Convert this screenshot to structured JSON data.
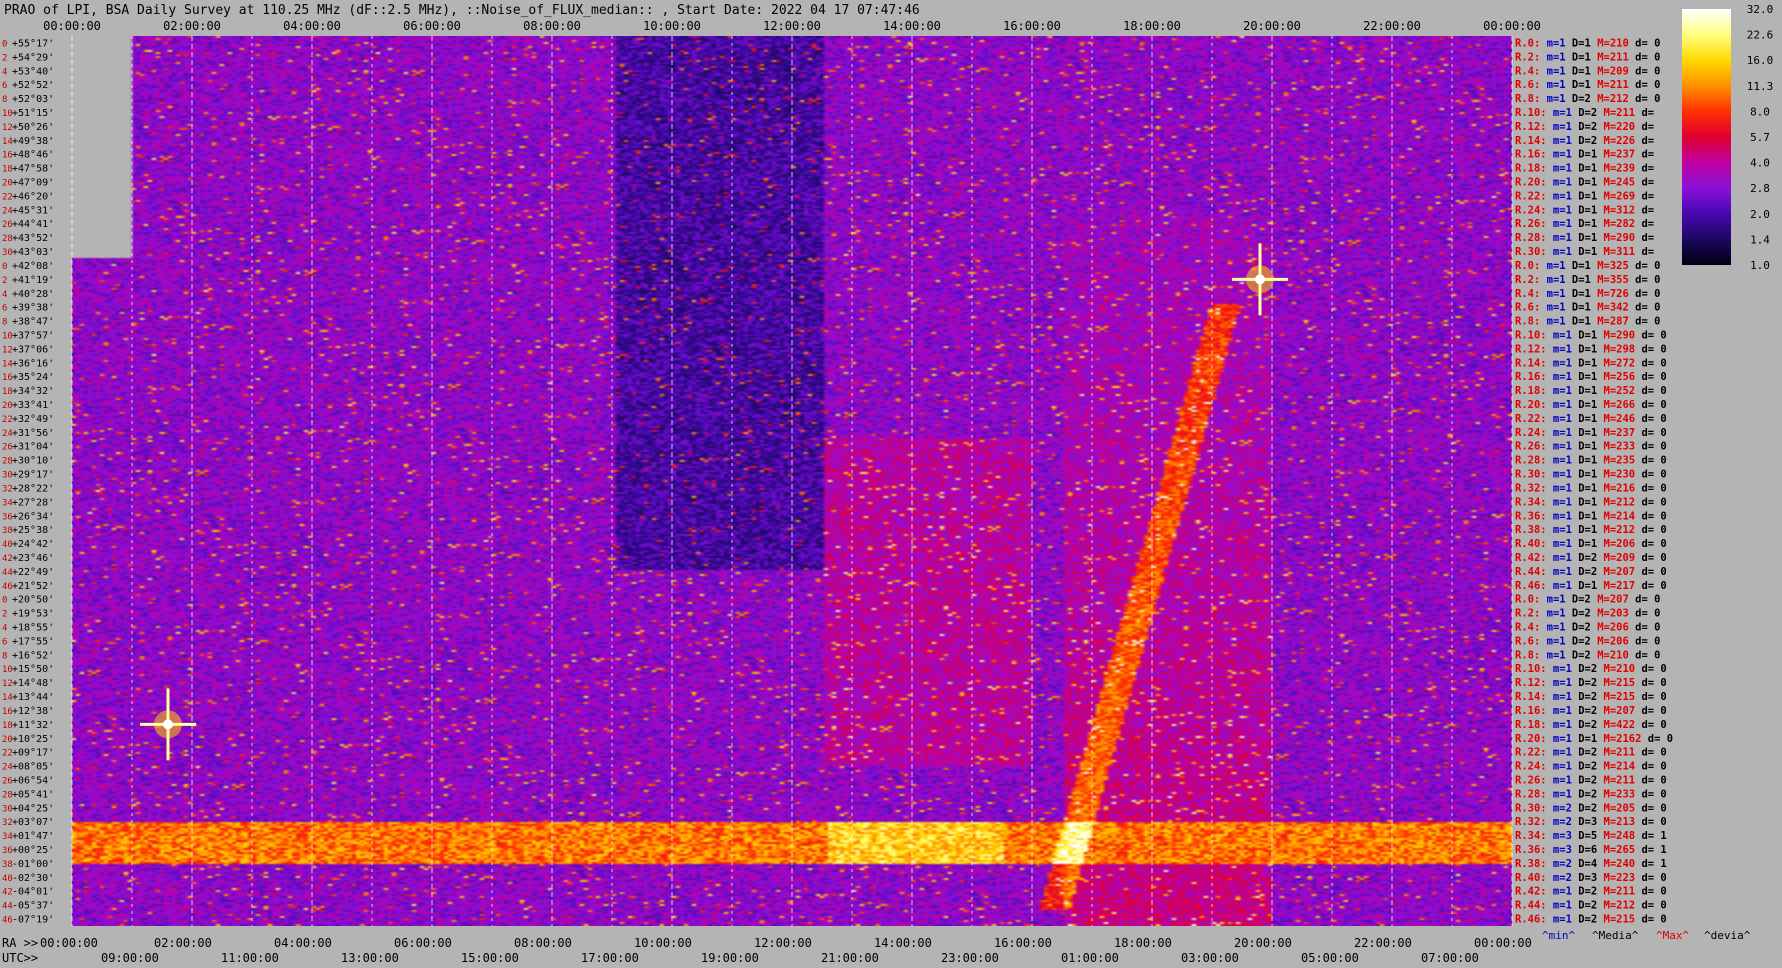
{
  "header": {
    "title": "PRAO of LPI, BSA Daily Survey at 110.25 MHz (dF::2.5 MHz), ::Noise_of_FLUX_median:: , Start Date: 2022 04 17 07:47:46"
  },
  "chart_data": {
    "type": "heatmap",
    "title": "PRAO of LPI, BSA Daily Survey at 110.25 MHz (dF::2.5 MHz), ::Noise_of_FLUX_median:: , Start Date: 2022 04 17 07:47:46",
    "x_top_ticks": [
      "00:00:00",
      "02:00:00",
      "04:00:00",
      "06:00:00",
      "08:00:00",
      "10:00:00",
      "12:00:00",
      "14:00:00",
      "16:00:00",
      "18:00:00",
      "20:00:00",
      "22:00:00",
      "00:00:00"
    ],
    "x_ra_prefix": "RA >>",
    "x_ra_ticks": [
      "00:00:00",
      "02:00:00",
      "04:00:00",
      "06:00:00",
      "08:00:00",
      "10:00:00",
      "12:00:00",
      "14:00:00",
      "16:00:00",
      "18:00:00",
      "20:00:00",
      "22:00:00",
      "00:00:00"
    ],
    "x_utc_prefix": "UTC>>",
    "x_utc_ticks": [
      "09:00:00",
      "11:00:00",
      "13:00:00",
      "15:00:00",
      "17:00:00",
      "19:00:00",
      "21:00:00",
      "23:00:00",
      "01:00:00",
      "03:00:00",
      "05:00:00",
      "07:00:00"
    ],
    "y_ticks": [
      "+55°17'",
      "+54°29'",
      "+53°40'",
      "+52°52'",
      "+52°03'",
      "+51°15'",
      "+50°26'",
      "+49°38'",
      "+48°46'",
      "+47°58'",
      "+47°09'",
      "+46°20'",
      "+45°31'",
      "+44°41'",
      "+43°52'",
      "+43°03'",
      "+42°08'",
      "+41°19'",
      "+40°28'",
      "+39°38'",
      "+38°47'",
      "+37°57'",
      "+37°06'",
      "+36°16'",
      "+35°24'",
      "+34°32'",
      "+33°41'",
      "+32°49'",
      "+31°56'",
      "+31°04'",
      "+30°10'",
      "+29°17'",
      "+28°22'",
      "+27°28'",
      "+26°34'",
      "+25°38'",
      "+24°42'",
      "+23°46'",
      "+22°49'",
      "+21°52'",
      "+20°50'",
      "+19°53'",
      "+18°55'",
      "+17°55'",
      "+16°52'",
      "+15°50'",
      "+14°48'",
      "+13°44'",
      "+12°38'",
      "+11°32'",
      "+10°25'",
      "+09°17'",
      "+08°05'",
      "+06°54'",
      "+05°41'",
      "+04°25'",
      "+03°07'",
      "+01°47'",
      "+00°25'",
      "-01°00'",
      "-02°30'",
      "-04°01'",
      "-05°37'",
      "-07°19'"
    ],
    "y_index_labels": [
      "0",
      "2",
      "4",
      "6",
      "8",
      "10",
      "12",
      "14",
      "16",
      "18",
      "20",
      "22",
      "24",
      "26",
      "28",
      "30",
      "0",
      "2",
      "4",
      "6",
      "8",
      "10",
      "12",
      "14",
      "16",
      "18",
      "20",
      "22",
      "24",
      "26",
      "28",
      "30",
      "32",
      "34",
      "36",
      "38",
      "40",
      "42",
      "44",
      "46",
      "0",
      "2",
      "4",
      "6",
      "8",
      "10",
      "12",
      "14",
      "16",
      "18",
      "20",
      "22",
      "24",
      "26",
      "28",
      "30",
      "32",
      "34",
      "36",
      "38",
      "40",
      "42",
      "44",
      "46"
    ],
    "colorbar": {
      "ticks": [
        32.0,
        22.6,
        16.0,
        11.3,
        8.0,
        5.7,
        4.0,
        2.8,
        2.0,
        1.4,
        1.0
      ],
      "tick_labels": [
        "32.0",
        "22.6",
        "16.0",
        "11.3",
        "8.0",
        "5.7",
        "4.0",
        "2.8",
        "2.0",
        "1.4",
        "1.0"
      ],
      "colors": [
        "#ffffff",
        "#ffff80",
        "#ffd800",
        "#ff9000",
        "#ff3000",
        "#e00030",
        "#c000a0",
        "#8a10d8",
        "#4808b0",
        "#1c0860",
        "#000010"
      ],
      "scale": "log2"
    },
    "features": {
      "bright_band_dec": [
        "+01°47'",
        "-01°00'"
      ],
      "sources": [
        {
          "ra_h": 1.6,
          "dec": "+11°32'"
        },
        {
          "ra_h": 19.8,
          "dec": "+41°19'"
        }
      ]
    }
  },
  "stats": {
    "rows": [
      {
        "r": "R.0:",
        "m": "m=1",
        "d": "D=1",
        "M": "M=210",
        "dv": "d= 0"
      },
      {
        "r": "R.2:",
        "m": "m=1",
        "d": "D=1",
        "M": "M=211",
        "dv": "d= 0"
      },
      {
        "r": "R.4:",
        "m": "m=1",
        "d": "D=1",
        "M": "M=209",
        "dv": "d= 0"
      },
      {
        "r": "R.6:",
        "m": "m=1",
        "d": "D=1",
        "M": "M=211",
        "dv": "d= 0"
      },
      {
        "r": "R.8:",
        "m": "m=1",
        "d": "D=2",
        "M": "M=212",
        "dv": "d= 0"
      },
      {
        "r": "R.10:",
        "m": "m=1",
        "d": "D=2",
        "M": "M=211",
        "dv": "d="
      },
      {
        "r": "R.12:",
        "m": "m=1",
        "d": "D=2",
        "M": "M=220",
        "dv": "d="
      },
      {
        "r": "R.14:",
        "m": "m=1",
        "d": "D=2",
        "M": "M=226",
        "dv": "d="
      },
      {
        "r": "R.16:",
        "m": "m=1",
        "d": "D=1",
        "M": "M=237",
        "dv": "d="
      },
      {
        "r": "R.18:",
        "m": "m=1",
        "d": "D=1",
        "M": "M=239",
        "dv": "d="
      },
      {
        "r": "R.20:",
        "m": "m=1",
        "d": "D=1",
        "M": "M=245",
        "dv": "d="
      },
      {
        "r": "R.22:",
        "m": "m=1",
        "d": "D=1",
        "M": "M=269",
        "dv": "d="
      },
      {
        "r": "R.24:",
        "m": "m=1",
        "d": "D=1",
        "M": "M=312",
        "dv": "d="
      },
      {
        "r": "R.26:",
        "m": "m=1",
        "d": "D=1",
        "M": "M=282",
        "dv": "d="
      },
      {
        "r": "R.28:",
        "m": "m=1",
        "d": "D=1",
        "M": "M=290",
        "dv": "d="
      },
      {
        "r": "R.30:",
        "m": "m=1",
        "d": "D=1",
        "M": "M=311",
        "dv": "d="
      },
      {
        "r": "R.0:",
        "m": "m=1",
        "d": "D=1",
        "M": "M=325",
        "dv": "d= 0"
      },
      {
        "r": "R.2:",
        "m": "m=1",
        "d": "D=1",
        "M": "M=355",
        "dv": "d= 0"
      },
      {
        "r": "R.4:",
        "m": "m=1",
        "d": "D=1",
        "M": "M=726",
        "dv": "d= 0"
      },
      {
        "r": "R.6:",
        "m": "m=1",
        "d": "D=1",
        "M": "M=342",
        "dv": "d= 0"
      },
      {
        "r": "R.8:",
        "m": "m=1",
        "d": "D=1",
        "M": "M=287",
        "dv": "d= 0"
      },
      {
        "r": "R.10:",
        "m": "m=1",
        "d": "D=1",
        "M": "M=290",
        "dv": "d= 0"
      },
      {
        "r": "R.12:",
        "m": "m=1",
        "d": "D=1",
        "M": "M=298",
        "dv": "d= 0"
      },
      {
        "r": "R.14:",
        "m": "m=1",
        "d": "D=1",
        "M": "M=272",
        "dv": "d= 0"
      },
      {
        "r": "R.16:",
        "m": "m=1",
        "d": "D=1",
        "M": "M=256",
        "dv": "d= 0"
      },
      {
        "r": "R.18:",
        "m": "m=1",
        "d": "D=1",
        "M": "M=252",
        "dv": "d= 0"
      },
      {
        "r": "R.20:",
        "m": "m=1",
        "d": "D=1",
        "M": "M=266",
        "dv": "d= 0"
      },
      {
        "r": "R.22:",
        "m": "m=1",
        "d": "D=1",
        "M": "M=246",
        "dv": "d= 0"
      },
      {
        "r": "R.24:",
        "m": "m=1",
        "d": "D=1",
        "M": "M=237",
        "dv": "d= 0"
      },
      {
        "r": "R.26:",
        "m": "m=1",
        "d": "D=1",
        "M": "M=233",
        "dv": "d= 0"
      },
      {
        "r": "R.28:",
        "m": "m=1",
        "d": "D=1",
        "M": "M=235",
        "dv": "d= 0"
      },
      {
        "r": "R.30:",
        "m": "m=1",
        "d": "D=1",
        "M": "M=230",
        "dv": "d= 0"
      },
      {
        "r": "R.32:",
        "m": "m=1",
        "d": "D=1",
        "M": "M=216",
        "dv": "d= 0"
      },
      {
        "r": "R.34:",
        "m": "m=1",
        "d": "D=1",
        "M": "M=212",
        "dv": "d= 0"
      },
      {
        "r": "R.36:",
        "m": "m=1",
        "d": "D=1",
        "M": "M=214",
        "dv": "d= 0"
      },
      {
        "r": "R.38:",
        "m": "m=1",
        "d": "D=1",
        "M": "M=212",
        "dv": "d= 0"
      },
      {
        "r": "R.40:",
        "m": "m=1",
        "d": "D=1",
        "M": "M=206",
        "dv": "d= 0"
      },
      {
        "r": "R.42:",
        "m": "m=1",
        "d": "D=2",
        "M": "M=209",
        "dv": "d= 0"
      },
      {
        "r": "R.44:",
        "m": "m=1",
        "d": "D=2",
        "M": "M=207",
        "dv": "d= 0"
      },
      {
        "r": "R.46:",
        "m": "m=1",
        "d": "D=1",
        "M": "M=217",
        "dv": "d= 0"
      },
      {
        "r": "R.0:",
        "m": "m=1",
        "d": "D=2",
        "M": "M=207",
        "dv": "d= 0"
      },
      {
        "r": "R.2:",
        "m": "m=1",
        "d": "D=2",
        "M": "M=203",
        "dv": "d= 0"
      },
      {
        "r": "R.4:",
        "m": "m=1",
        "d": "D=2",
        "M": "M=206",
        "dv": "d= 0"
      },
      {
        "r": "R.6:",
        "m": "m=1",
        "d": "D=2",
        "M": "M=206",
        "dv": "d= 0"
      },
      {
        "r": "R.8:",
        "m": "m=1",
        "d": "D=2",
        "M": "M=210",
        "dv": "d= 0"
      },
      {
        "r": "R.10:",
        "m": "m=1",
        "d": "D=2",
        "M": "M=210",
        "dv": "d= 0"
      },
      {
        "r": "R.12:",
        "m": "m=1",
        "d": "D=2",
        "M": "M=215",
        "dv": "d= 0"
      },
      {
        "r": "R.14:",
        "m": "m=1",
        "d": "D=2",
        "M": "M=215",
        "dv": "d= 0"
      },
      {
        "r": "R.16:",
        "m": "m=1",
        "d": "D=2",
        "M": "M=207",
        "dv": "d= 0"
      },
      {
        "r": "R.18:",
        "m": "m=1",
        "d": "D=2",
        "M": "M=422",
        "dv": "d= 0"
      },
      {
        "r": "R.20:",
        "m": "m=1",
        "d": "D=1",
        "M": "M=2162",
        "dv": "d= 0"
      },
      {
        "r": "R.22:",
        "m": "m=1",
        "d": "D=2",
        "M": "M=211",
        "dv": "d= 0"
      },
      {
        "r": "R.24:",
        "m": "m=1",
        "d": "D=2",
        "M": "M=214",
        "dv": "d= 0"
      },
      {
        "r": "R.26:",
        "m": "m=1",
        "d": "D=2",
        "M": "M=211",
        "dv": "d= 0"
      },
      {
        "r": "R.28:",
        "m": "m=1",
        "d": "D=2",
        "M": "M=233",
        "dv": "d= 0"
      },
      {
        "r": "R.30:",
        "m": "m=2",
        "d": "D=2",
        "M": "M=205",
        "dv": "d= 0"
      },
      {
        "r": "R.32:",
        "m": "m=2",
        "d": "D=3",
        "M": "M=213",
        "dv": "d= 0"
      },
      {
        "r": "R.34:",
        "m": "m=3",
        "d": "D=5",
        "M": "M=248",
        "dv": "d= 1"
      },
      {
        "r": "R.36:",
        "m": "m=3",
        "d": "D=6",
        "M": "M=265",
        "dv": "d= 1"
      },
      {
        "r": "R.38:",
        "m": "m=2",
        "d": "D=4",
        "M": "M=240",
        "dv": "d= 1"
      },
      {
        "r": "R.40:",
        "m": "m=2",
        "d": "D=3",
        "M": "M=223",
        "dv": "d= 0"
      },
      {
        "r": "R.42:",
        "m": "m=1",
        "d": "D=2",
        "M": "M=211",
        "dv": "d= 0"
      },
      {
        "r": "R.44:",
        "m": "m=1",
        "d": "D=2",
        "M": "M=212",
        "dv": "d= 0"
      },
      {
        "r": "R.46:",
        "m": "m=1",
        "d": "D=2",
        "M": "M=215",
        "dv": "d= 0"
      }
    ]
  },
  "footer_legend": {
    "min": "^min^",
    "median": "^Media^",
    "max": "^Max^",
    "devia": "^devia^"
  },
  "colors": {
    "background": "#b4b4b4",
    "stat_r": "#e00000",
    "stat_m": "#0000c0",
    "stat_d": "#000000",
    "stat_M": "#e00000",
    "stat_dv": "#000000"
  }
}
